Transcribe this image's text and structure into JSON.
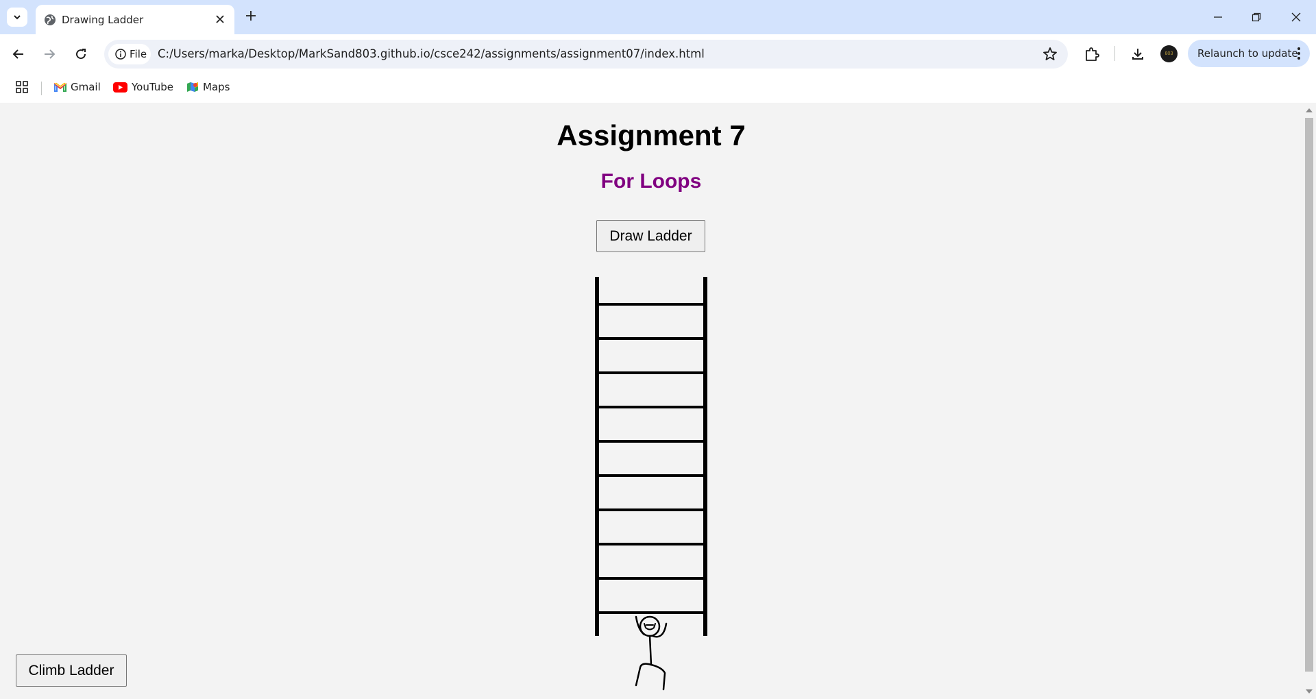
{
  "browser": {
    "tab_title": "Drawing Ladder",
    "site_chip_label": "File",
    "url": "C:/Users/marka/Desktop/MarkSand803.github.io/csce242/assignments/assignment07/index.html",
    "relaunch_label": "Relaunch to update",
    "avatar_text": "803",
    "bookmarks": [
      {
        "label": "Gmail",
        "icon": "gmail-icon"
      },
      {
        "label": "YouTube",
        "icon": "youtube-icon"
      },
      {
        "label": "Maps",
        "icon": "maps-icon"
      }
    ]
  },
  "page": {
    "title": "Assignment 7",
    "subtitle": "For Loops",
    "draw_button_label": "Draw Ladder",
    "climb_button_label": "Climb Ladder",
    "ladder_rungs": 10,
    "colors": {
      "subtitle": "#800080",
      "background": "#f3f3f3",
      "chrome_tabstrip": "#d3e3fd"
    }
  }
}
